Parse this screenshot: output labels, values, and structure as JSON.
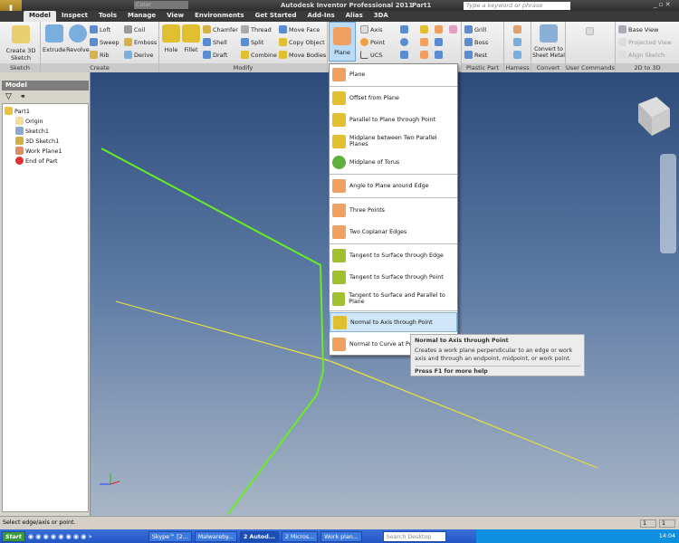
{
  "titlebar": {
    "app_title": "Autodesk Inventor Professional 2011",
    "document": "Part1",
    "style_combo": "Color",
    "search_placeholder": "Type a keyword or phrase",
    "logo_badge": "PRO"
  },
  "tabs": [
    "Model",
    "Inspect",
    "Tools",
    "Manage",
    "View",
    "Environments",
    "Get Started",
    "Add-Ins",
    "Alias",
    "3DA"
  ],
  "ribbon": {
    "sketch": {
      "label": "Sketch",
      "create_3d_sketch": "Create 3D Sketch"
    },
    "create": {
      "label": "Create",
      "extrude": "Extrude",
      "revolve": "Revolve",
      "loft": "Loft",
      "sweep": "Sweep",
      "rib": "Rib",
      "coil": "Coil",
      "emboss": "Emboss",
      "derive": "Derive"
    },
    "modify": {
      "label": "Modify",
      "hole": "Hole",
      "fillet": "Fillet",
      "chamfer": "Chamfer",
      "shell": "Shell",
      "draft": "Draft",
      "thread": "Thread",
      "split": "Split",
      "combine": "Combine",
      "move_face": "Move Face",
      "copy_object": "Copy Object",
      "move_bodies": "Move Bodies"
    },
    "work": {
      "plane": "Plane",
      "axis": "Axis",
      "point": "Point",
      "ucs": "UCS"
    },
    "plastic": {
      "label": "Plastic Part",
      "grill": "Grill",
      "boss": "Boss",
      "rest": "Rest"
    },
    "harness": {
      "label": "Harness"
    },
    "convert": {
      "label": "Convert",
      "convert_sheet_metal": "Convert to Sheet Metal"
    },
    "user_commands": {
      "label": "User Commands"
    },
    "two_d_to_3d": {
      "label": "2D to 3D",
      "base_view": "Base View",
      "projected_view": "Projected View",
      "align_sketch": "Align Sketch"
    }
  },
  "browser": {
    "title": "Model",
    "tree": [
      "Part1",
      "Origin",
      "Sketch1",
      "3D Sketch1",
      "Work Plane1",
      "End of Part"
    ]
  },
  "plane_menu": [
    "Plane",
    "Offset from Plane",
    "Parallel to Plane through Point",
    "Midplane between Two Parallel Planes",
    "Midplane of Torus",
    "Angle to Plane around Edge",
    "Three Points",
    "Two Coplanar Edges",
    "Tangent to Surface through Edge",
    "Tangent to Surface through Point",
    "Tangent to Surface and Parallel to Plane",
    "Normal to Axis through Point",
    "Normal to Curve at Point"
  ],
  "tooltip": {
    "title": "Normal to Axis through Point",
    "body": "Creates a work plane perpendicular to an edge or work axis and through an endpoint, midpoint, or work point.",
    "help": "Press F1 for more help"
  },
  "status": {
    "message": "Select edge/axis or point.",
    "count1": "1",
    "count2": "1"
  },
  "taskbar": {
    "start": "Start",
    "items": [
      "Skype™ [2...",
      "Malwareby...",
      "2 Autod...",
      "2 Micros...",
      "Work plan..."
    ],
    "search_placeholder": "Search Desktop",
    "clock": "14:04"
  },
  "colors": {
    "sketch_line": "#66ee22",
    "work_plane": "#8a6a7a",
    "menu_highlight": "#cfe6f8"
  }
}
